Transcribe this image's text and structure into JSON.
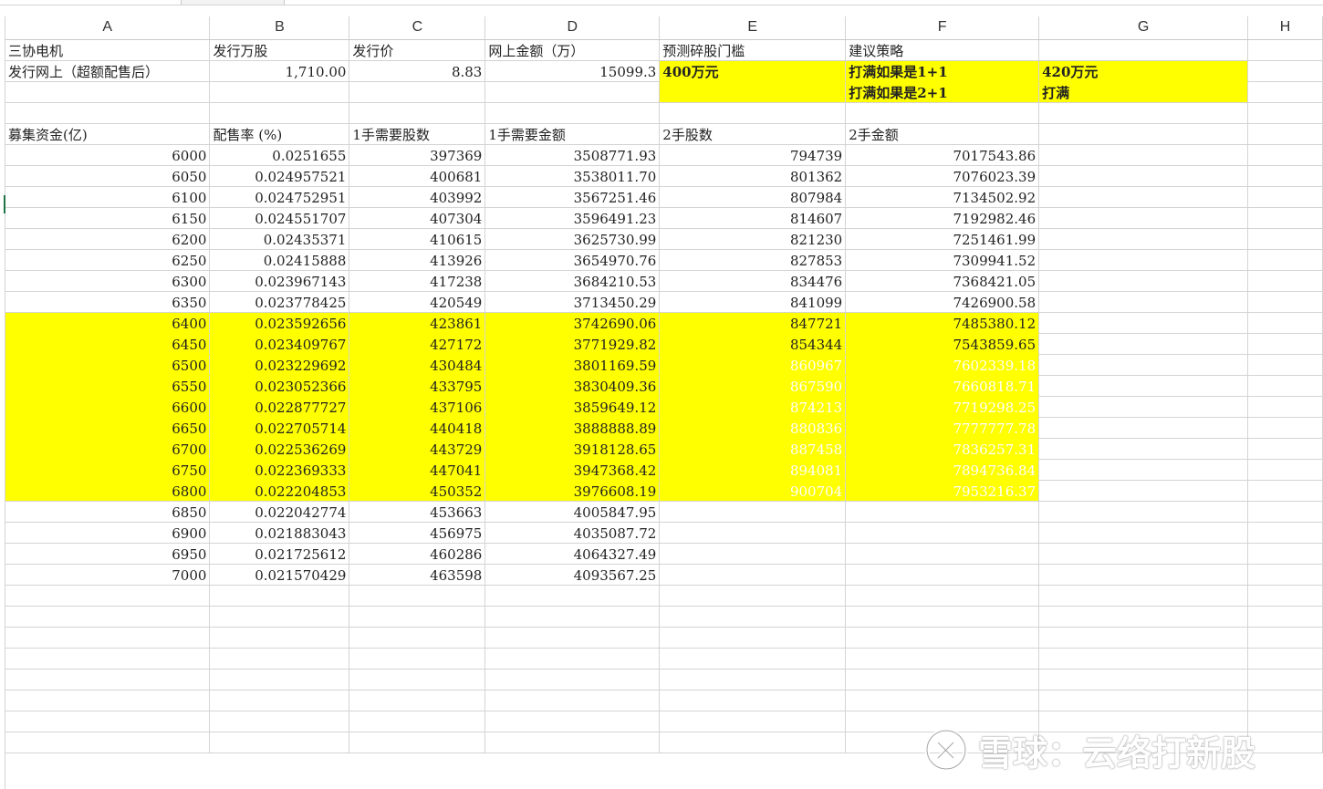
{
  "columns": [
    "A",
    "B",
    "C",
    "D",
    "E",
    "F",
    "G",
    "H"
  ],
  "summary_rows": [
    [
      "三协电机",
      "发行万股",
      "发行价",
      "网上金额（万）",
      "预测碎股门槛",
      "建议策略",
      "",
      ""
    ],
    [
      "发行网上（超额配售后）",
      "1,710.00",
      "8.83",
      "15099.3",
      "400万元",
      "打满如果是1+1",
      "420万元",
      ""
    ],
    [
      "",
      "",
      "",
      "",
      "",
      "打满如果是2+1",
      "打满",
      ""
    ],
    [
      "",
      "",
      "",
      "",
      "",
      "",
      "",
      ""
    ],
    [
      "募集资金(亿)",
      "配售率 (%)",
      "1手需要股数",
      "1手需要金额",
      "2手股数",
      "2手金额",
      "",
      ""
    ]
  ],
  "data_rows": [
    [
      "6000",
      "0.0251655",
      "397369",
      "3508771.93",
      "794739",
      "7017543.86"
    ],
    [
      "6050",
      "0.024957521",
      "400681",
      "3538011.70",
      "801362",
      "7076023.39"
    ],
    [
      "6100",
      "0.024752951",
      "403992",
      "3567251.46",
      "807984",
      "7134502.92"
    ],
    [
      "6150",
      "0.024551707",
      "407304",
      "3596491.23",
      "814607",
      "7192982.46"
    ],
    [
      "6200",
      "0.02435371",
      "410615",
      "3625730.99",
      "821230",
      "7251461.99"
    ],
    [
      "6250",
      "0.02415888",
      "413926",
      "3654970.76",
      "827853",
      "7309941.52"
    ],
    [
      "6300",
      "0.023967143",
      "417238",
      "3684210.53",
      "834476",
      "7368421.05"
    ],
    [
      "6350",
      "0.023778425",
      "420549",
      "3713450.29",
      "841099",
      "7426900.58"
    ],
    [
      "6400",
      "0.023592656",
      "423861",
      "3742690.06",
      "847721",
      "7485380.12"
    ],
    [
      "6450",
      "0.023409767",
      "427172",
      "3771929.82",
      "854344",
      "7543859.65"
    ],
    [
      "6500",
      "0.023229692",
      "430484",
      "3801169.59",
      "860967",
      "7602339.18"
    ],
    [
      "6550",
      "0.023052366",
      "433795",
      "3830409.36",
      "867590",
      "7660818.71"
    ],
    [
      "6600",
      "0.022877727",
      "437106",
      "3859649.12",
      "874213",
      "7719298.25"
    ],
    [
      "6650",
      "0.022705714",
      "440418",
      "3888888.89",
      "880836",
      "7777777.78"
    ],
    [
      "6700",
      "0.022536269",
      "443729",
      "3918128.65",
      "887458",
      "7836257.31"
    ],
    [
      "6750",
      "0.022369333",
      "447041",
      "3947368.42",
      "894081",
      "7894736.84"
    ],
    [
      "6800",
      "0.022204853",
      "450352",
      "3976608.19",
      "900704",
      "7953216.37"
    ],
    [
      "6850",
      "0.022042774",
      "453663",
      "4005847.95",
      "",
      ""
    ],
    [
      "6900",
      "0.021883043",
      "456975",
      "4035087.72",
      "",
      ""
    ],
    [
      "6950",
      "0.021725612",
      "460286",
      "4064327.49",
      "",
      ""
    ],
    [
      "7000",
      "0.021570429",
      "463598",
      "4093567.25",
      "",
      ""
    ]
  ],
  "highlight": {
    "first_row": 8,
    "last_row": 16,
    "white_text_from_row": 10,
    "color": "#ffff00"
  },
  "blank_rows": 8,
  "watermark": {
    "text": "雪球：云络打新股"
  }
}
